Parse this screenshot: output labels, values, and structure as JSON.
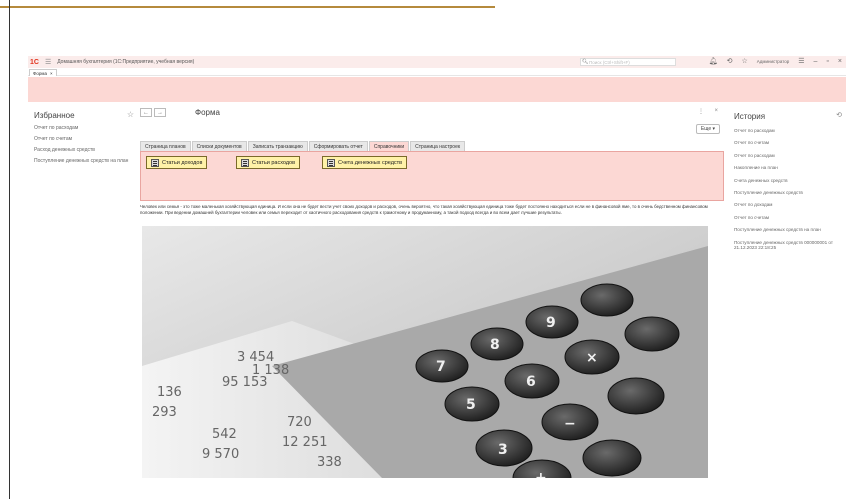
{
  "titlebar": {
    "app_title": "Домашняя бухгалтерия  (1С:Предприятие, учебная версия)",
    "logo": "1С",
    "search_placeholder": "Поиск (Ctrl+Shift+F)",
    "user": "Администратор"
  },
  "open_tabs": [
    {
      "label": "Форма",
      "close": "×"
    }
  ],
  "favorites": {
    "title": "Избранное",
    "items": [
      "Отчет по расходам",
      "Отчет по счетам",
      "Расход денежных средств",
      "Поступление денежных средств на план"
    ]
  },
  "form": {
    "back": "←",
    "forward": "→",
    "title": "Форма",
    "more_icon": "⋮",
    "close_icon": "×",
    "more_button": "Еще ▾",
    "tabs": [
      "Страница планов",
      "Списки документов",
      "Записать транзакцию",
      "Сформировать отчет",
      "Справочники",
      "Страница настроек"
    ],
    "active_tab": "Справочники",
    "buttons": [
      "Статьи доходов",
      "Статьи расходов",
      "Счета денежных средств"
    ],
    "description": "Человек или семья - это тоже маленькая хозяйствующая единица. И если она не будет вести учет своих доходов и расходов, очень вероятно, что такая хозяйствующая единица тоже будет постоянно находиться если не в финансовой яме, то в очень бедственном финансовом положении. При ведении домашней бухгалтерии человек или семья переходит от хаотичного расходования средств к грамотному и продуманному, а такой подход всегда и во всем дает лучшие результаты.",
    "photo_numbers": [
      "542",
      "9 570",
      "720",
      "12 251",
      "338",
      "95 153",
      "136",
      "293",
      "3 454",
      "1 138"
    ]
  },
  "history": {
    "title": "История",
    "items": [
      "Отчет по расходам",
      "Отчет по счетам",
      "Отчет по расходам",
      "Накопление на план",
      "Счета денежных средств",
      "Поступление денежных средств",
      "Отчет по доходам",
      "Отчет по счетам",
      "Поступление денежных средств на план",
      "Поступление денежных средств 000000001 от 21.12.2023 22:18:25"
    ]
  },
  "colors": {
    "accent_pink": "#fcd8d4",
    "button_yellow": "#fff2a8",
    "logo_red": "#e2331e"
  }
}
